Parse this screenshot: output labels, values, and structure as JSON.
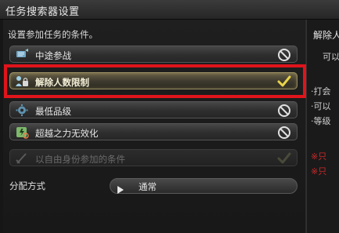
{
  "window": {
    "title": "任务搜索器设置"
  },
  "heading": "设置参加任务的条件。",
  "options": [
    {
      "label": "中途参战",
      "icon": "scroll-icon",
      "state": "off"
    },
    {
      "label": "解除人数限制",
      "icon": "people-lock-icon",
      "state": "on"
    },
    {
      "label": "最低品级",
      "icon": "gear-icon",
      "state": "off"
    },
    {
      "label": "超越之力无效化",
      "icon": "power-icon",
      "state": "off"
    },
    {
      "label": "以自由身份参加的条件",
      "icon": "sword-icon",
      "state": "disabled"
    }
  ],
  "distribution": {
    "label": "分配方式",
    "value": "通常"
  },
  "right_panel": {
    "title": "解除人",
    "line1": "可以",
    "line2": "·打会",
    "line3": "·可以",
    "line4": "·等级",
    "note1": "※只",
    "note2": "※只"
  },
  "colors": {
    "highlight": "#e0141b",
    "check": "#e8d24a",
    "note": "#cc2a2a"
  }
}
